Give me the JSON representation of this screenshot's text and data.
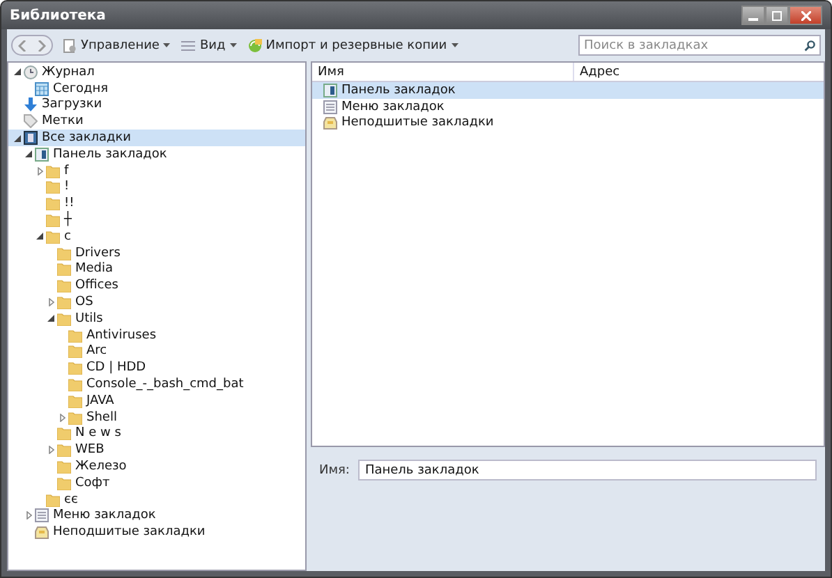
{
  "window": {
    "title": "Библиотека"
  },
  "toolbar": {
    "buttons": [
      {
        "label": "Управление",
        "kind": "organize"
      },
      {
        "label": "Вид",
        "kind": "view"
      },
      {
        "label": "Импорт и резервные копии",
        "kind": "import"
      }
    ],
    "search": {
      "placeholder": "Поиск в закладках"
    }
  },
  "sidebar": {
    "items": [
      {
        "label": "Журнал",
        "kind": "history",
        "expanded": true,
        "selected": false,
        "children": [
          {
            "label": "Сегодня",
            "kind": "calendar",
            "selected": false
          }
        ]
      },
      {
        "label": "Загрузки",
        "kind": "download",
        "selected": false
      },
      {
        "label": "Метки",
        "kind": "tags",
        "selected": false
      },
      {
        "label": "Все закладки",
        "kind": "library",
        "expanded": true,
        "selected": true,
        "children": [
          {
            "label": "Панель закладок",
            "kind": "toolbar",
            "expanded": true,
            "selected": false,
            "children": [
              {
                "label": "f",
                "kind": "folder",
                "expanded": false,
                "selected": false
              },
              {
                "label": "!",
                "kind": "folder",
                "selected": false
              },
              {
                "label": "!!",
                "kind": "folder",
                "selected": false
              },
              {
                "label": "┼",
                "kind": "folder",
                "selected": false
              },
              {
                "label": "c",
                "kind": "folder",
                "expanded": true,
                "selected": false,
                "children": [
                  {
                    "label": "Drivers",
                    "kind": "folder",
                    "selected": false
                  },
                  {
                    "label": "Media",
                    "kind": "folder",
                    "selected": false
                  },
                  {
                    "label": "Offices",
                    "kind": "folder",
                    "selected": false
                  },
                  {
                    "label": "OS",
                    "kind": "folder",
                    "expanded": false,
                    "selected": false
                  },
                  {
                    "label": "Utils",
                    "kind": "folder",
                    "expanded": true,
                    "selected": false,
                    "children": [
                      {
                        "label": "Antiviruses",
                        "kind": "folder",
                        "selected": false
                      },
                      {
                        "label": "Arc",
                        "kind": "folder",
                        "selected": false
                      },
                      {
                        "label": "CD | HDD",
                        "kind": "folder",
                        "selected": false
                      },
                      {
                        "label": "Console_-_bash_cmd_bat",
                        "kind": "folder",
                        "selected": false
                      },
                      {
                        "label": "JAVA",
                        "kind": "folder",
                        "selected": false
                      },
                      {
                        "label": "Shell",
                        "kind": "folder",
                        "expanded": false,
                        "selected": false
                      }
                    ]
                  },
                  {
                    "label": "N e w s",
                    "kind": "folder",
                    "selected": false
                  },
                  {
                    "label": "WEB",
                    "kind": "folder",
                    "expanded": false,
                    "selected": false
                  },
                  {
                    "label": "Железо",
                    "kind": "folder",
                    "selected": false
                  },
                  {
                    "label": "Софт",
                    "kind": "folder",
                    "selected": false
                  }
                ]
              },
              {
                "label": "єє",
                "kind": "folder",
                "selected": false
              }
            ]
          },
          {
            "label": "Меню закладок",
            "kind": "menu",
            "expanded": false,
            "selected": false
          },
          {
            "label": "Неподшитые закладки",
            "kind": "unsorted",
            "selected": false
          }
        ]
      }
    ]
  },
  "list": {
    "columns": [
      "Имя",
      "Адрес"
    ],
    "rows": [
      {
        "name": "Панель закладок",
        "kind": "toolbar",
        "selected": true
      },
      {
        "name": "Меню закладок",
        "kind": "menu",
        "selected": false
      },
      {
        "name": "Неподшитые закладки",
        "kind": "unsorted",
        "selected": false
      }
    ]
  },
  "details": {
    "label": "Имя:",
    "value": "Панель закладок"
  }
}
